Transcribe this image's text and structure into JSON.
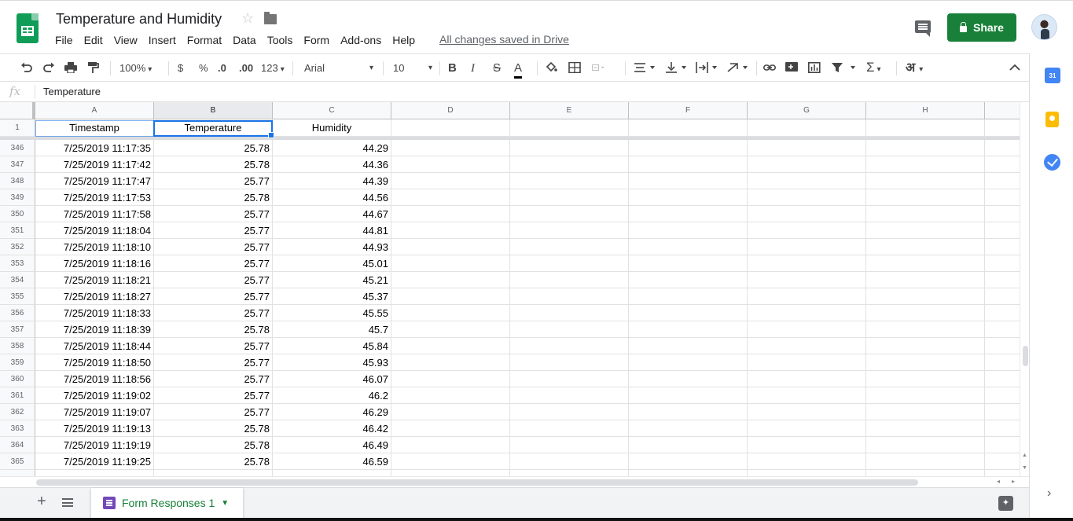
{
  "doc": {
    "title": "Temperature and Humidity",
    "saved_status": "All changes saved in Drive"
  },
  "menu": [
    "File",
    "Edit",
    "View",
    "Insert",
    "Format",
    "Data",
    "Tools",
    "Form",
    "Add-ons",
    "Help"
  ],
  "header_actions": {
    "share_label": "Share"
  },
  "toolbar": {
    "zoom": "100%",
    "currency": "$",
    "percent": "%",
    "dec_decrease": ".0",
    "dec_increase": ".00",
    "more_formats": "123",
    "font": "Arial",
    "font_size": "10",
    "bold": "B",
    "italic": "I",
    "strike": "S",
    "text_color": "A",
    "sigma": "Σ",
    "input_tools": "अ"
  },
  "formula_bar": {
    "value": "Temperature"
  },
  "columns": [
    "A",
    "B",
    "C",
    "D",
    "E",
    "F",
    "G",
    "H"
  ],
  "header_row": {
    "number": "1",
    "cells": [
      "Timestamp",
      "Temperature",
      "Humidity"
    ]
  },
  "rows": [
    {
      "n": "346",
      "ts": "7/25/2019 11:17:35",
      "temp": "25.78",
      "hum": "44.29"
    },
    {
      "n": "347",
      "ts": "7/25/2019 11:17:42",
      "temp": "25.78",
      "hum": "44.36"
    },
    {
      "n": "348",
      "ts": "7/25/2019 11:17:47",
      "temp": "25.77",
      "hum": "44.39"
    },
    {
      "n": "349",
      "ts": "7/25/2019 11:17:53",
      "temp": "25.78",
      "hum": "44.56"
    },
    {
      "n": "350",
      "ts": "7/25/2019 11:17:58",
      "temp": "25.77",
      "hum": "44.67"
    },
    {
      "n": "351",
      "ts": "7/25/2019 11:18:04",
      "temp": "25.77",
      "hum": "44.81"
    },
    {
      "n": "352",
      "ts": "7/25/2019 11:18:10",
      "temp": "25.77",
      "hum": "44.93"
    },
    {
      "n": "353",
      "ts": "7/25/2019 11:18:16",
      "temp": "25.77",
      "hum": "45.01"
    },
    {
      "n": "354",
      "ts": "7/25/2019 11:18:21",
      "temp": "25.77",
      "hum": "45.21"
    },
    {
      "n": "355",
      "ts": "7/25/2019 11:18:27",
      "temp": "25.77",
      "hum": "45.37"
    },
    {
      "n": "356",
      "ts": "7/25/2019 11:18:33",
      "temp": "25.77",
      "hum": "45.55"
    },
    {
      "n": "357",
      "ts": "7/25/2019 11:18:39",
      "temp": "25.78",
      "hum": "45.7"
    },
    {
      "n": "358",
      "ts": "7/25/2019 11:18:44",
      "temp": "25.77",
      "hum": "45.84"
    },
    {
      "n": "359",
      "ts": "7/25/2019 11:18:50",
      "temp": "25.77",
      "hum": "45.93"
    },
    {
      "n": "360",
      "ts": "7/25/2019 11:18:56",
      "temp": "25.77",
      "hum": "46.07"
    },
    {
      "n": "361",
      "ts": "7/25/2019 11:19:02",
      "temp": "25.77",
      "hum": "46.2"
    },
    {
      "n": "362",
      "ts": "7/25/2019 11:19:07",
      "temp": "25.77",
      "hum": "46.29"
    },
    {
      "n": "363",
      "ts": "7/25/2019 11:19:13",
      "temp": "25.78",
      "hum": "46.42"
    },
    {
      "n": "364",
      "ts": "7/25/2019 11:19:19",
      "temp": "25.78",
      "hum": "46.49"
    },
    {
      "n": "365",
      "ts": "7/25/2019 11:19:25",
      "temp": "25.78",
      "hum": "46.59"
    }
  ],
  "sheet_tab": {
    "label": "Form Responses 1"
  },
  "side_panel": {
    "calendar_day": "31"
  },
  "colors": {
    "brand_green": "#0f9d58",
    "share_green": "#188038",
    "selection_blue": "#1a73e8"
  }
}
